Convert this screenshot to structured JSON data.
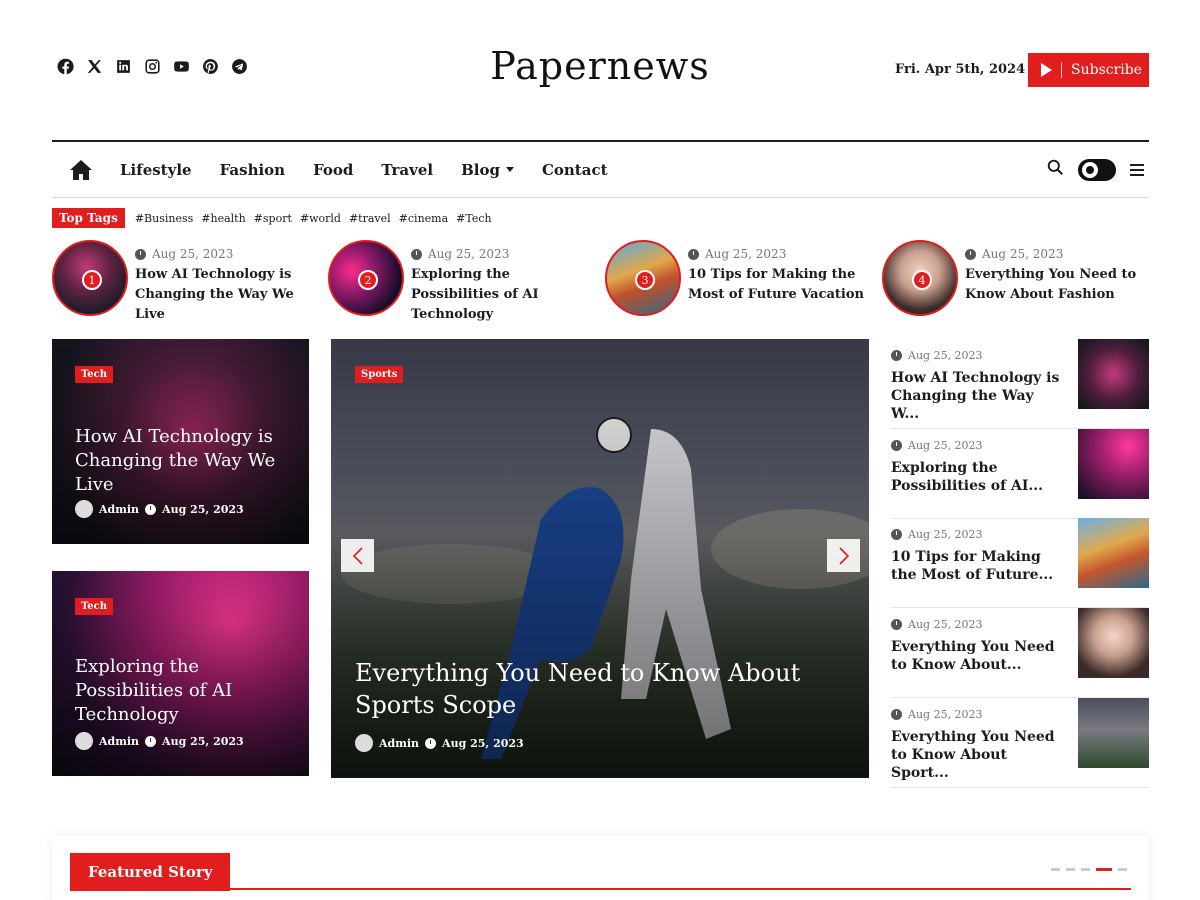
{
  "site": {
    "title": "Papernews",
    "date": "Fri. Apr 5th, 2024",
    "subscribe_label": "Subscribe",
    "social_icons": [
      "facebook-icon",
      "x-icon",
      "linkedin-icon",
      "instagram-icon",
      "youtube-icon",
      "pinterest-icon",
      "telegram-icon"
    ]
  },
  "colors": {
    "accent": "#e11d1d",
    "text": "#1c1c1c",
    "meta": "#777777"
  },
  "nav": {
    "items": [
      "Lifestyle",
      "Fashion",
      "Food",
      "Travel",
      "Blog",
      "Contact"
    ]
  },
  "tags": {
    "label": "Top Tags",
    "items": [
      "#Business",
      "#health",
      "#sport",
      "#world",
      "#travel",
      "#cinema",
      "#Tech"
    ]
  },
  "trending": [
    {
      "num": "1",
      "date": "Aug 25, 2023",
      "title": "How AI Technology is Changing the Way We Live"
    },
    {
      "num": "2",
      "date": "Aug 25, 2023",
      "title": "Exploring the Possibilities of AI Technology"
    },
    {
      "num": "3",
      "date": "Aug 25, 2023",
      "title": "10 Tips for Making the Most of Future Vacation"
    },
    {
      "num": "4",
      "date": "Aug 25, 2023",
      "title": "Everything You Need to Know About Fashion"
    }
  ],
  "left_cards": [
    {
      "category": "Tech",
      "title": "How AI Technology is Changing the Way We Live",
      "author": "Admin",
      "date": "Aug 25, 2023"
    },
    {
      "category": "Tech",
      "title": "Exploring the Possibilities of AI Technology",
      "author": "Admin",
      "date": "Aug 25, 2023"
    }
  ],
  "main_slide": {
    "category": "Sports",
    "title": "Everything You Need to Know About Sports Scope",
    "author": "Admin",
    "date": "Aug 25, 2023"
  },
  "side_list": [
    {
      "date": "Aug 25, 2023",
      "title": "How AI Technology is Changing the Way W..."
    },
    {
      "date": "Aug 25, 2023",
      "title": "Exploring the Possibilities of AI..."
    },
    {
      "date": "Aug 25, 2023",
      "title": "10 Tips for Making the Most of Future..."
    },
    {
      "date": "Aug 25, 2023",
      "title": "Everything You Need to Know About..."
    },
    {
      "date": "Aug 25, 2023",
      "title": "Everything You Need to Know About Sport..."
    }
  ],
  "featured": {
    "label": "Featured Story",
    "active_dot": 4,
    "dot_count": 5
  }
}
